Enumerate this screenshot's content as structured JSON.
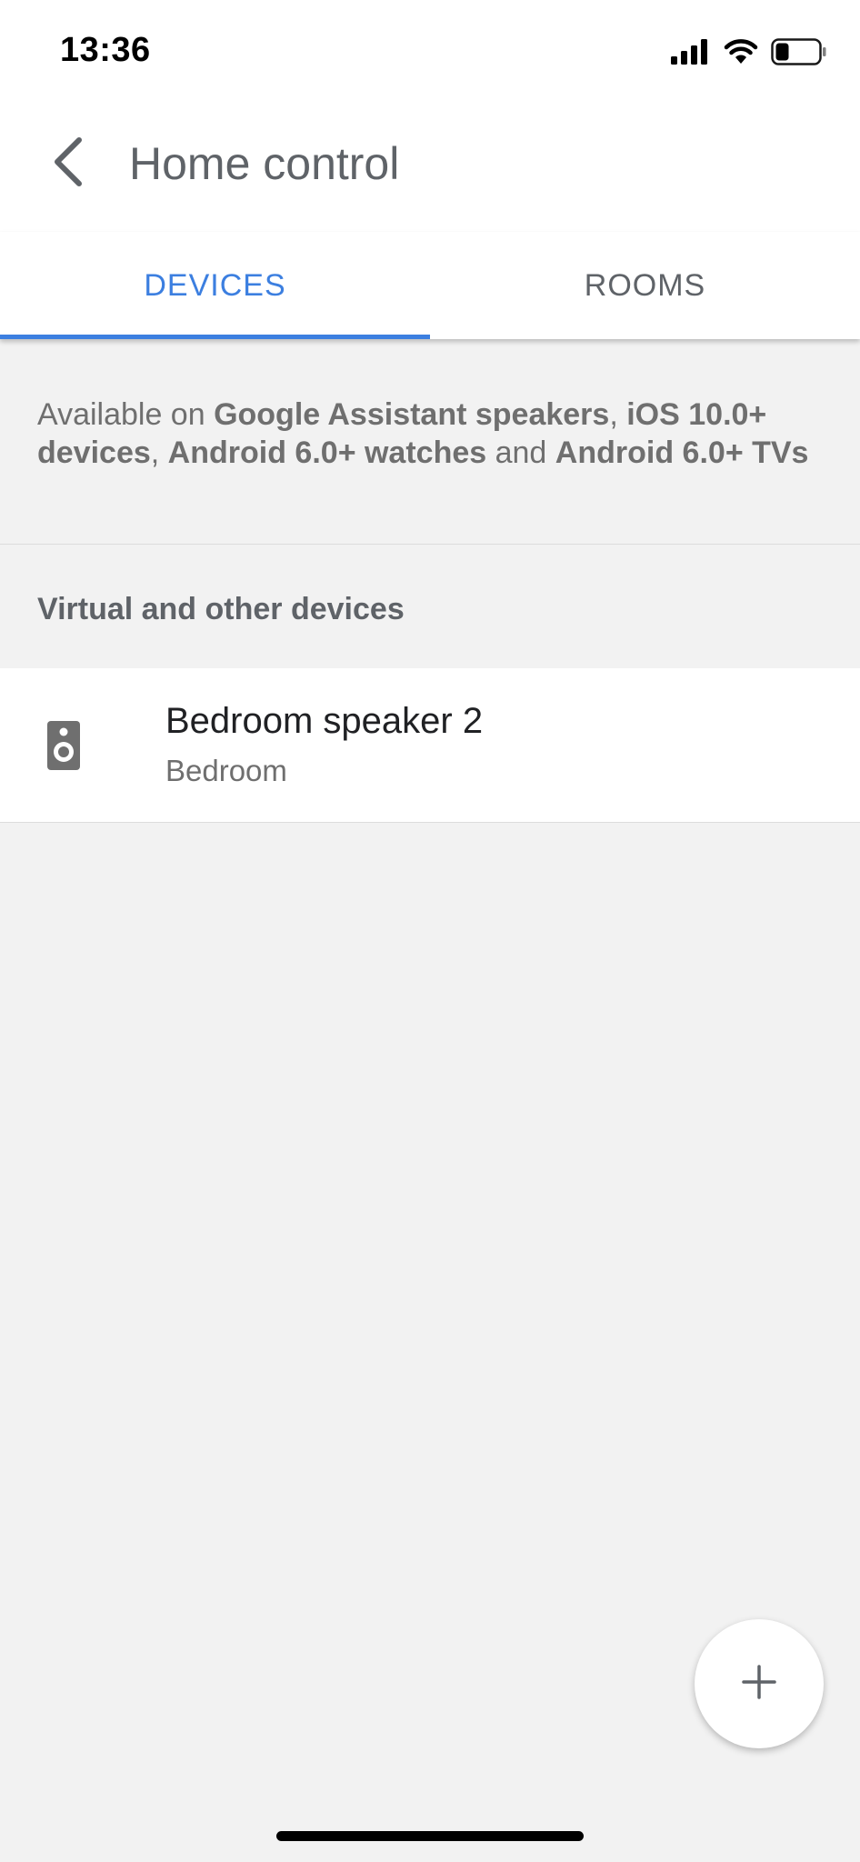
{
  "status_bar": {
    "time": "13:36",
    "icons": [
      "signal-icon",
      "wifi-icon",
      "battery-icon"
    ],
    "battery_level": 0.3
  },
  "header": {
    "title": "Home control",
    "back_icon": "back-arrow-icon"
  },
  "tabs": [
    {
      "label": "DEVICES",
      "active": true
    },
    {
      "label": "ROOMS",
      "active": false
    }
  ],
  "info": {
    "prefix": "Available on ",
    "item1": "Google Assistant speakers",
    "sep1": ", ",
    "item2": "iOS 10.0+ devices",
    "sep2": ", ",
    "item3": "Android 6.0+ watches",
    "sep3": " and ",
    "item4": "Android 6.0+ TVs"
  },
  "section": {
    "header": "Virtual and other devices"
  },
  "devices": [
    {
      "name": "Bedroom speaker 2",
      "room": "Bedroom",
      "icon": "speaker-icon"
    }
  ],
  "fab": {
    "icon": "plus-icon"
  },
  "colors": {
    "accent": "#3c7fe0",
    "background": "#f2f2f2",
    "text_secondary": "#5f6368"
  }
}
